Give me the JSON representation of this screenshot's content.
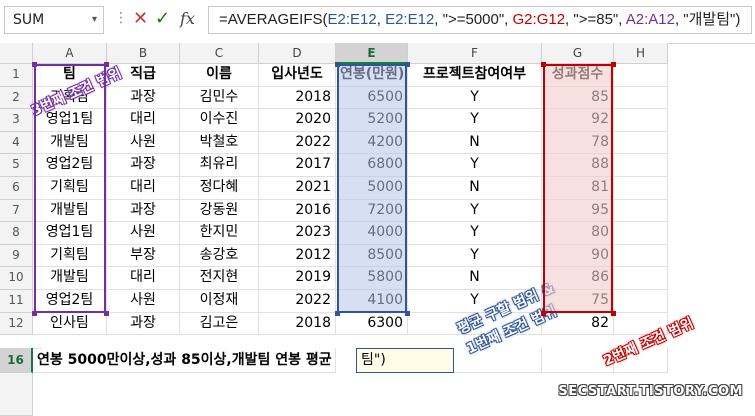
{
  "namebox": {
    "value": "SUM",
    "dropdown_icon": "chevron-down-icon"
  },
  "formula_bar": {
    "cancel_icon": "✕",
    "enter_icon": "✓",
    "fx_label": "fx",
    "formula_parts": [
      {
        "text": "=AVERAGEIFS(",
        "color": "#222222"
      },
      {
        "text": "E2:E12",
        "color": "#2f5597"
      },
      {
        "text": ", ",
        "color": "#222222"
      },
      {
        "text": "E2:E12",
        "color": "#2f5597"
      },
      {
        "text": ", \">=5000\", ",
        "color": "#222222"
      },
      {
        "text": "G2:G12",
        "color": "#c00000"
      },
      {
        "text": ", \">=85\", ",
        "color": "#222222"
      },
      {
        "text": "A2:A12",
        "color": "#7030a0"
      },
      {
        "text": ", \"개발팀\")",
        "color": "#222222"
      }
    ]
  },
  "columns": [
    "A",
    "B",
    "C",
    "D",
    "E",
    "F",
    "G",
    "H"
  ],
  "selected_column": "E",
  "header_row": {
    "row": "1",
    "cells": [
      "팀",
      "직급",
      "이름",
      "입사년도",
      "연봉(만원)",
      "프로젝트참여여부",
      "성과점수",
      ""
    ]
  },
  "rows": [
    {
      "row": "2",
      "cells": [
        "기획팀",
        "과장",
        "김민수",
        "2018",
        "6500",
        "Y",
        "85"
      ]
    },
    {
      "row": "3",
      "cells": [
        "영업1팀",
        "대리",
        "이수진",
        "2020",
        "5200",
        "Y",
        "92"
      ]
    },
    {
      "row": "4",
      "cells": [
        "개발팀",
        "사원",
        "박철호",
        "2022",
        "4200",
        "N",
        "78"
      ]
    },
    {
      "row": "5",
      "cells": [
        "영업2팀",
        "과장",
        "최유리",
        "2017",
        "6800",
        "Y",
        "88"
      ]
    },
    {
      "row": "6",
      "cells": [
        "기획팀",
        "대리",
        "정다혜",
        "2021",
        "5000",
        "N",
        "81"
      ]
    },
    {
      "row": "7",
      "cells": [
        "개발팀",
        "과장",
        "강동원",
        "2016",
        "7200",
        "Y",
        "95"
      ]
    },
    {
      "row": "8",
      "cells": [
        "영업1팀",
        "사원",
        "한지민",
        "2023",
        "4000",
        "Y",
        "80"
      ]
    },
    {
      "row": "9",
      "cells": [
        "기획팀",
        "부장",
        "송강호",
        "2012",
        "8500",
        "Y",
        "90"
      ]
    },
    {
      "row": "10",
      "cells": [
        "개발팀",
        "대리",
        "전지현",
        "2019",
        "5800",
        "N",
        "86"
      ]
    },
    {
      "row": "11",
      "cells": [
        "영업2팀",
        "사원",
        "이정재",
        "2022",
        "4100",
        "Y",
        "75"
      ]
    },
    {
      "row": "12",
      "cells": [
        "인사팀",
        "과장",
        "김고은",
        "2018",
        "6300",
        "Y",
        "82"
      ]
    }
  ],
  "summary_row": {
    "row": "16",
    "label": "연봉 5000만이상,성과 85이상,개발팀 연봉 평균",
    "edit_value": "팀\")"
  },
  "annotations": {
    "condition3": "3번째 조건 범위",
    "avg_range": "평균 구할 범위 &",
    "condition1": "1번째 조건 범위",
    "condition2": "2번째 조건 범위"
  },
  "watermark": "SECSTART.TISTORY.COM",
  "colors": {
    "criteria1": "#2f5597",
    "criteria2": "#c00000",
    "criteria3": "#7030a0",
    "selected_header": "#107c41"
  }
}
